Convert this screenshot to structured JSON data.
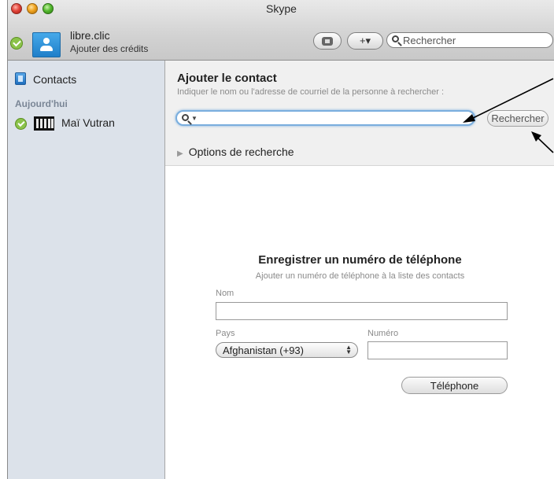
{
  "window": {
    "title": "Skype"
  },
  "account": {
    "name": "libre.clic",
    "credits_link": "Ajouter des crédits"
  },
  "toolbar": {
    "add_label": "+▾",
    "search_placeholder": "Rechercher"
  },
  "sidebar": {
    "contacts_label": "Contacts",
    "section_today": "Aujourd'hui",
    "recent": [
      {
        "name": "Maï Vutran"
      }
    ]
  },
  "add_contact": {
    "title": "Ajouter le contact",
    "hint": "Indiquer le nom ou l'adresse de courriel de la personne à rechercher :",
    "search_value": "",
    "search_button": "Rechercher",
    "options_label": "Options de recherche"
  },
  "register_phone": {
    "title": "Enregistrer un numéro de téléphone",
    "subtitle": "Ajouter un numéro de téléphone à la liste des contacts",
    "name_label": "Nom",
    "name_value": "",
    "country_label": "Pays",
    "country_value": "Afghanistan (+93)",
    "number_label": "Numéro",
    "number_value": "",
    "phone_button": "Téléphone"
  },
  "colors": {
    "sidebar_bg": "#dce2ea",
    "focus_ring": "#7aaede",
    "status_online": "#8bc34a",
    "avatar_blue": "#1f7fc9"
  }
}
